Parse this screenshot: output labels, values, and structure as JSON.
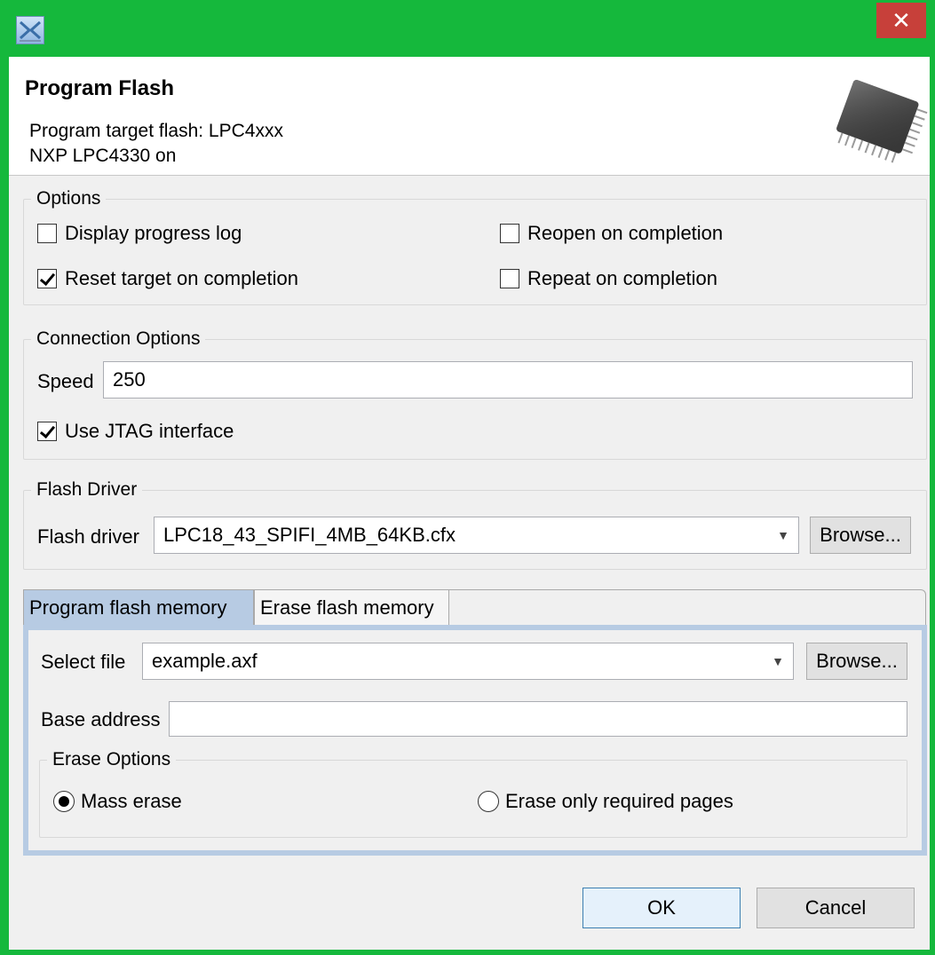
{
  "window": {
    "close_glyph": "✕"
  },
  "header": {
    "title": "Program Flash",
    "message_line1": "Program target flash: LPC4xxx",
    "message_line2": "NXP LPC4330 on"
  },
  "options": {
    "legend": "Options",
    "display_progress_log": {
      "label": "Display progress log",
      "checked": false
    },
    "reopen_on_completion": {
      "label": "Reopen on completion",
      "checked": false
    },
    "reset_target_on_completion": {
      "label": "Reset target on completion",
      "checked": true
    },
    "repeat_on_completion": {
      "label": "Repeat on completion",
      "checked": false
    }
  },
  "connection": {
    "legend": "Connection Options",
    "speed_label": "Speed",
    "speed_value": "250",
    "use_jtag": {
      "label": "Use JTAG interface",
      "checked": true
    }
  },
  "flash_driver": {
    "legend": "Flash Driver",
    "label": "Flash driver",
    "value": "LPC18_43_SPIFI_4MB_64KB.cfx",
    "browse_label": "Browse..."
  },
  "tabs": [
    {
      "label": "Program flash memory",
      "active": true
    },
    {
      "label": "Erase flash memory",
      "active": false
    }
  ],
  "program_tab": {
    "select_file_label": "Select file",
    "select_file_value": "example.axf",
    "browse_label": "Browse...",
    "base_address_label": "Base address",
    "base_address_value": "",
    "erase_options": {
      "legend": "Erase Options",
      "mass_erase": {
        "label": "Mass erase",
        "selected": true
      },
      "erase_required": {
        "label": "Erase only required pages",
        "selected": false
      }
    }
  },
  "footer": {
    "ok_label": "OK",
    "cancel_label": "Cancel"
  },
  "colors": {
    "frame": "#15b83c",
    "close": "#c7403a",
    "tab_active": "#b7cbe3"
  },
  "icons": [
    "app-icon",
    "close-icon",
    "chip-icon",
    "dropdown-arrow-icon"
  ]
}
